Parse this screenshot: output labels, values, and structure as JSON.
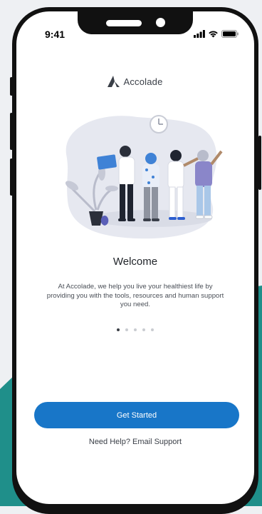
{
  "status_bar": {
    "time": "9:41"
  },
  "brand": {
    "name": "Accolade"
  },
  "onboarding": {
    "title": "Welcome",
    "description": "At Accolade, we help you live your healthiest life by providing you with the tools, resources and human support you need.",
    "page_count": 5,
    "active_page": 1
  },
  "actions": {
    "primary_label": "Get Started",
    "help_label": "Need Help? Email Support"
  },
  "colors": {
    "background": "#eef0f3",
    "accent_teal": "#1f8f8a",
    "primary_button": "#1876c8"
  },
  "icons": [
    "accolade-logo-icon",
    "signal-icon",
    "wifi-icon",
    "battery-icon",
    "clock-icon"
  ]
}
